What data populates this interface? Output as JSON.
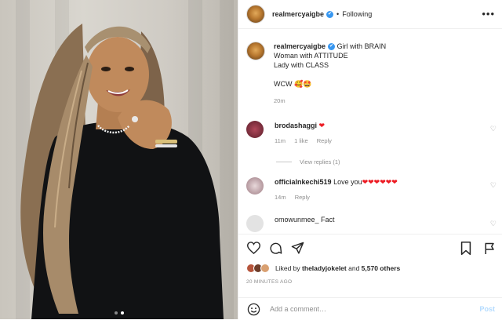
{
  "post": {
    "username": "realmercyaigbe",
    "verified_mark": "✔",
    "separator": "•",
    "follow_status": "Following",
    "more_label": "•••",
    "photo_count": 2,
    "active_photo": 2
  },
  "caption": {
    "username": "realmercyaigbe",
    "line1": "Girl with BRAIN",
    "line2": "Woman with ATTITUDE",
    "line3": "Lady with CLASS",
    "line4": "WCW 🥰🤩",
    "age": "20m"
  },
  "comments": [
    {
      "username": "brodashaggi",
      "text": "❤",
      "age": "11m",
      "likes": "1 like",
      "reply_label": "Reply",
      "avatar_color": "#7a2a3a"
    },
    {
      "username": "officialnkechi519",
      "text": "Love you",
      "hearts": "❤❤❤❤❤❤",
      "age": "14m",
      "reply_label": "Reply",
      "avatar_color": "#c9b4b8"
    },
    {
      "username": "omowunmee_",
      "text": "Fact",
      "avatar_color": "#e6e6e6"
    }
  ],
  "view_replies": "View replies (1)",
  "likes": {
    "prefix": "Liked by",
    "user": "theladyjokelet",
    "suffix": "and",
    "count": "5,570 others"
  },
  "timestamp": "20 MINUTES AGO",
  "add_comment": {
    "placeholder": "Add a comment…",
    "post_label": "Post"
  },
  "icons": {
    "like": "heart-icon",
    "comment": "comment-icon",
    "share": "share-icon",
    "save": "bookmark-icon",
    "report": "report-icon",
    "emoji": "smile-icon"
  },
  "colors": {
    "verified": "#3897f0",
    "heart": "#ed1c24",
    "muted": "#8e8e8e",
    "post_disabled": "#b3dbff"
  }
}
